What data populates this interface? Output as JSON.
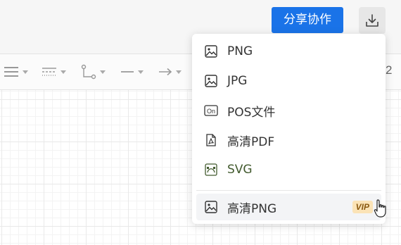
{
  "header": {
    "share_label": "分享协作",
    "download_icon": "download-icon"
  },
  "toolbar": {
    "tools": [
      "line-align-icon",
      "dash-style-icon",
      "connector-icon",
      "line-style-icon",
      "arrow-style-icon"
    ],
    "edge_text": "2"
  },
  "export_menu": {
    "items": [
      {
        "label": "PNG",
        "icon": "image-icon"
      },
      {
        "label": "JPG",
        "icon": "image-icon"
      },
      {
        "label": "POS文件",
        "icon": "pos-file-icon"
      },
      {
        "label": "高清PDF",
        "icon": "pdf-icon"
      },
      {
        "label": "SVG",
        "icon": "svg-icon"
      }
    ],
    "premium_item": {
      "label": "高清PNG",
      "icon": "image-icon",
      "badge": "VIP"
    }
  },
  "colors": {
    "accent": "#1a73e8",
    "svg_label": "#425a2e",
    "vip_bg": "#fbe3b6",
    "vip_text": "#8a5a12"
  }
}
